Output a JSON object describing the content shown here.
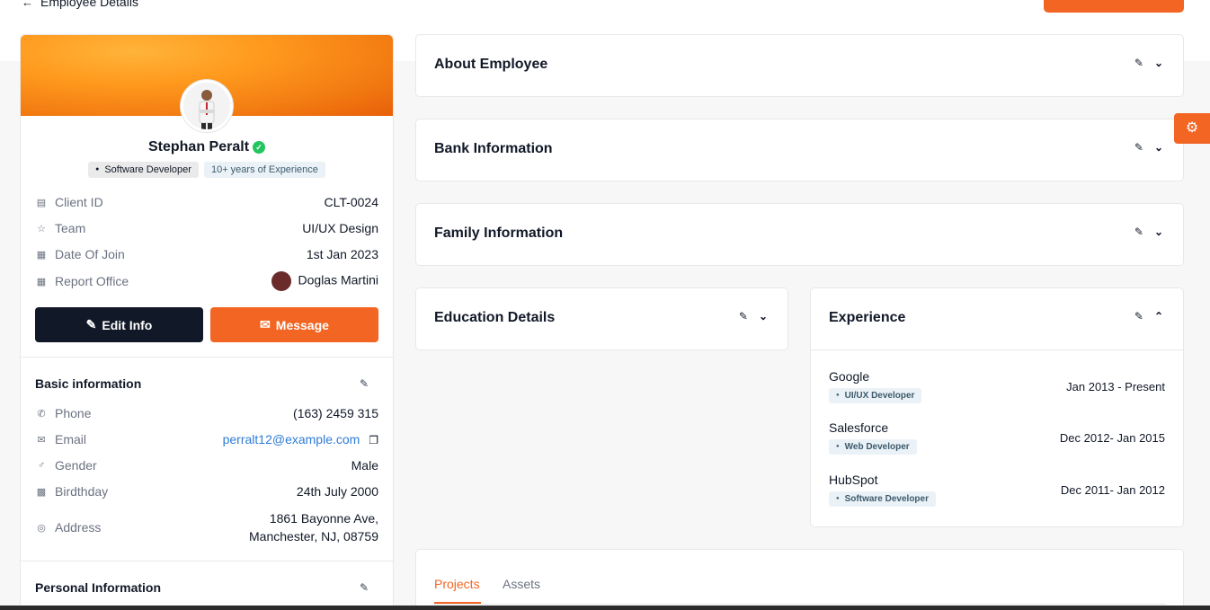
{
  "header": {
    "back_icon": "arrow-left-icon",
    "title": "Employee Details"
  },
  "profile": {
    "name": "Stephan Peralt",
    "role_badge": "Software Developer",
    "experience_badge": "10+ years of Experience",
    "rows": [
      {
        "icon": "id-card-icon",
        "label": "Client ID",
        "value": "CLT-0024"
      },
      {
        "icon": "star-icon",
        "label": "Team",
        "value": "UI/UX Design"
      },
      {
        "icon": "calendar-icon",
        "label": "Date Of Join",
        "value": "1st Jan 2023"
      },
      {
        "icon": "calendar-icon",
        "label": "Report Office",
        "value": "Doglas Martini"
      }
    ],
    "edit_button": "Edit Info",
    "message_button": "Message"
  },
  "basic_info": {
    "title": "Basic information",
    "rows": [
      {
        "icon": "phone-icon",
        "label": "Phone",
        "value": "(163) 2459 315"
      },
      {
        "icon": "mail-icon",
        "label": "Email",
        "value": "perralt12@example.com"
      },
      {
        "icon": "gender-icon",
        "label": "Gender",
        "value": "Male"
      },
      {
        "icon": "cake-icon",
        "label": "Birdthday",
        "value": "24th July 2000"
      },
      {
        "icon": "location-icon",
        "label": "Address",
        "value_line1": "1861 Bayonne Ave,",
        "value_line2": "Manchester, NJ, 08759"
      }
    ]
  },
  "personal_info": {
    "title": "Personal Information"
  },
  "sections": {
    "about": "About Employee",
    "bank": "Bank Information",
    "family": "Family Information",
    "education": "Education Details",
    "experience": "Experience"
  },
  "experience": [
    {
      "company": "Google",
      "role": "UI/UX Developer",
      "dates": "Jan 2013 - Present"
    },
    {
      "company": "Salesforce",
      "role": "Web Developer",
      "dates": "Dec 2012- Jan 2015"
    },
    {
      "company": "HubSpot",
      "role": "Software Developer",
      "dates": "Dec 2011- Jan 2012"
    }
  ],
  "tabs": [
    "Projects",
    "Assets"
  ],
  "colors": {
    "accent": "#f26522",
    "dark": "#111827",
    "verified": "#22c55e",
    "link": "#2f7bd6"
  }
}
